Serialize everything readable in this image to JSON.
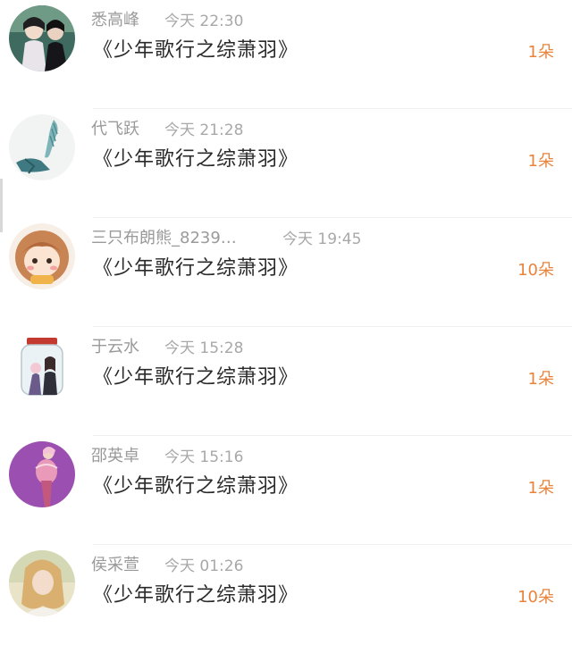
{
  "items": [
    {
      "name": "悉高峰",
      "time": "今天 22:30",
      "title": "《少年歌行之综萧羽》",
      "count": "1朵",
      "avatar": "avatar-dark-costume"
    },
    {
      "name": "代飞跃",
      "time": "今天 21:28",
      "title": "《少年歌行之综萧羽》",
      "count": "1朵",
      "avatar": "avatar-teal-sketch"
    },
    {
      "name": "三只布朗熊_8239…",
      "time": "今天 19:45",
      "title": "《少年歌行之综萧羽》",
      "count": "10朵",
      "avatar": "avatar-cartoon-girl"
    },
    {
      "name": "于云水",
      "time": "今天 15:28",
      "title": "《少年歌行之综萧羽》",
      "count": "1朵",
      "avatar": "avatar-jar-couple"
    },
    {
      "name": "邵英卓",
      "time": "今天 15:16",
      "title": "《少年歌行之综萧羽》",
      "count": "1朵",
      "avatar": "avatar-purple-figure"
    },
    {
      "name": "侯采萱",
      "time": "今天 01:26",
      "title": "《少年歌行之综萧羽》",
      "count": "10朵",
      "avatar": "avatar-blonde-portrait"
    }
  ],
  "colors": {
    "name": "#9a9a9a",
    "time": "#a8a8a8",
    "title": "#2a2a2a",
    "count": "#e9833b"
  }
}
